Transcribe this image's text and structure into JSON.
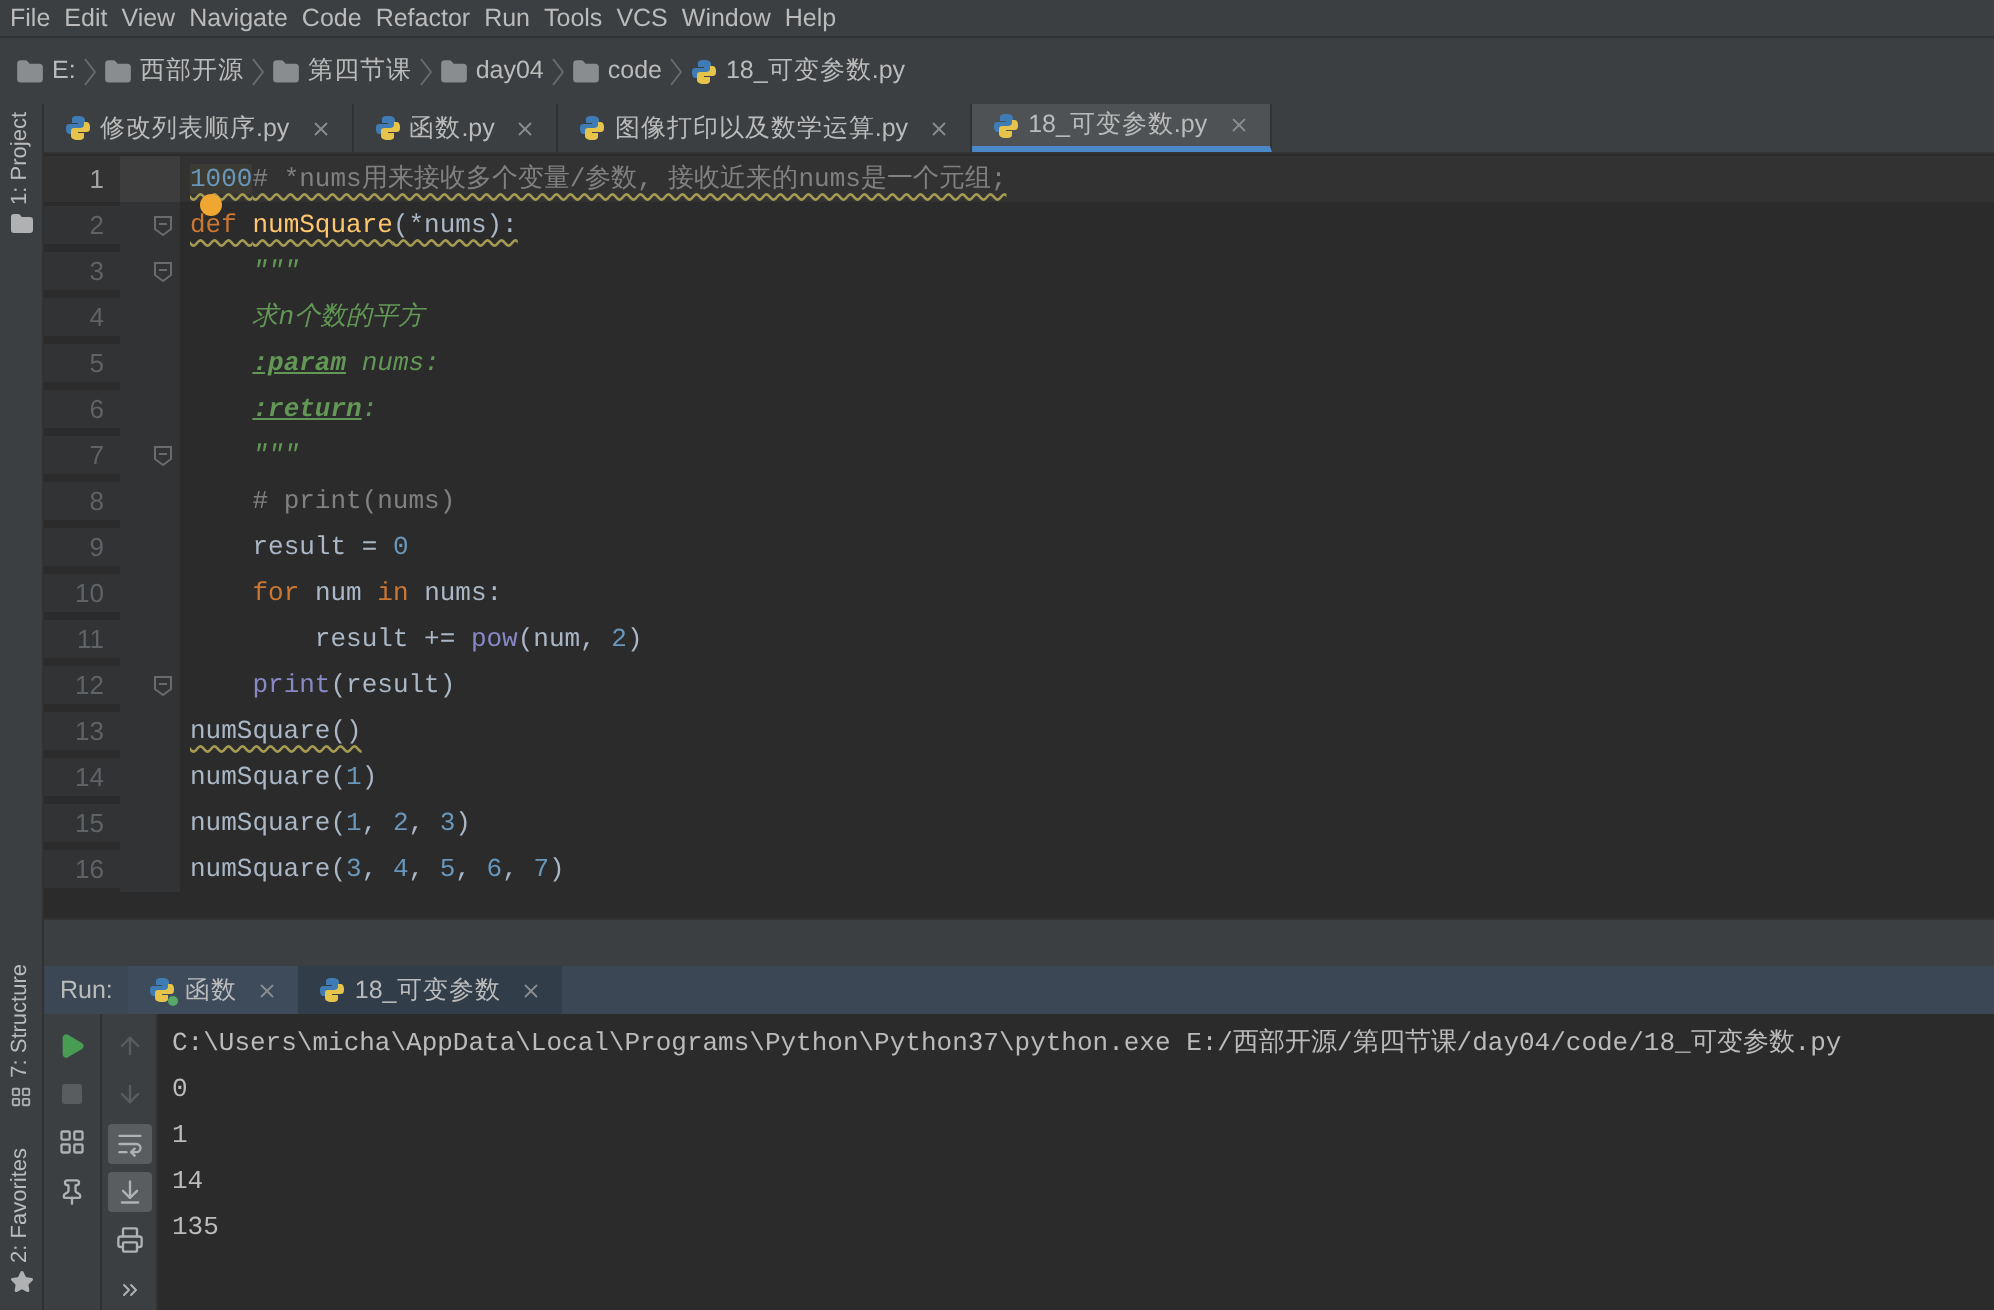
{
  "menu": [
    "File",
    "Edit",
    "View",
    "Navigate",
    "Code",
    "Refactor",
    "Run",
    "Tools",
    "VCS",
    "Window",
    "Help"
  ],
  "breadcrumb": [
    {
      "label": "E:",
      "kind": "folder"
    },
    {
      "label": "西部开源",
      "kind": "folder"
    },
    {
      "label": "第四节课",
      "kind": "folder"
    },
    {
      "label": "day04",
      "kind": "folder"
    },
    {
      "label": "code",
      "kind": "folder"
    },
    {
      "label": "18_可变参数.py",
      "kind": "file"
    }
  ],
  "left_tools": {
    "top": "1: Project",
    "middle": "7: Structure",
    "bottom": "2: Favorites"
  },
  "editor_tabs": [
    {
      "label": "修改列表顺序.py",
      "selected": false
    },
    {
      "label": "函数.py",
      "selected": false
    },
    {
      "label": "图像打印以及数学运算.py",
      "selected": false
    },
    {
      "label": "18_可变参数.py",
      "selected": true
    }
  ],
  "code_lines": [
    {
      "number": "1",
      "current": true,
      "warning": true,
      "fold": false,
      "bulb": false,
      "tokens": [
        {
          "text": "1000",
          "kind": "highlight"
        },
        {
          "text": "# *nums用来接收多个变量/参数, 接收近来的nums是一个元组;",
          "kind": "comment"
        }
      ]
    },
    {
      "number": "2",
      "current": false,
      "warning": true,
      "fold": true,
      "bulb": true,
      "tokens": [
        {
          "text": "def ",
          "kind": "keyword"
        },
        {
          "text": "numSquare",
          "kind": "funcdef"
        },
        {
          "text": "(*nums):",
          "kind": "plain"
        }
      ]
    },
    {
      "number": "3",
      "current": false,
      "warning": false,
      "fold": true,
      "bulb": false,
      "tokens": [
        {
          "text": "    \"\"\"",
          "kind": "doc"
        }
      ]
    },
    {
      "number": "4",
      "current": false,
      "warning": false,
      "fold": false,
      "bulb": false,
      "tokens": [
        {
          "text": "    求n个数的平方",
          "kind": "doc"
        }
      ]
    },
    {
      "number": "5",
      "current": false,
      "warning": false,
      "fold": false,
      "bulb": false,
      "tokens": [
        {
          "text": "    :param",
          "kind": "doctag"
        },
        {
          "text": " nums:",
          "kind": "doc"
        }
      ]
    },
    {
      "number": "6",
      "current": false,
      "warning": false,
      "fold": false,
      "bulb": false,
      "tokens": [
        {
          "text": "    :return",
          "kind": "doctag"
        },
        {
          "text": ":",
          "kind": "doc"
        }
      ]
    },
    {
      "number": "7",
      "current": false,
      "warning": false,
      "fold": true,
      "bulb": false,
      "tokens": [
        {
          "text": "    \"\"\"",
          "kind": "doc"
        }
      ]
    },
    {
      "number": "8",
      "current": false,
      "warning": false,
      "fold": false,
      "bulb": false,
      "tokens": [
        {
          "text": "    # print(nums)",
          "kind": "comment"
        }
      ]
    },
    {
      "number": "9",
      "current": false,
      "warning": false,
      "fold": false,
      "bulb": false,
      "tokens": [
        {
          "text": "    result = ",
          "kind": "plain"
        },
        {
          "text": "0",
          "kind": "number"
        }
      ]
    },
    {
      "number": "10",
      "current": false,
      "warning": false,
      "fold": false,
      "bulb": false,
      "tokens": [
        {
          "text": "    for",
          "kind": "keyword"
        },
        {
          "text": " num ",
          "kind": "plain"
        },
        {
          "text": "in",
          "kind": "keyword"
        },
        {
          "text": " nums:",
          "kind": "plain"
        }
      ]
    },
    {
      "number": "11",
      "current": false,
      "warning": false,
      "fold": false,
      "bulb": false,
      "tokens": [
        {
          "text": "        result += ",
          "kind": "plain"
        },
        {
          "text": "pow",
          "kind": "builtin"
        },
        {
          "text": "(num, ",
          "kind": "plain"
        },
        {
          "text": "2",
          "kind": "number"
        },
        {
          "text": ")",
          "kind": "plain"
        }
      ]
    },
    {
      "number": "12",
      "current": false,
      "warning": false,
      "fold": true,
      "bulb": false,
      "tokens": [
        {
          "text": "    print",
          "kind": "builtin"
        },
        {
          "text": "(result)",
          "kind": "plain"
        }
      ]
    },
    {
      "number": "13",
      "current": false,
      "warning": true,
      "fold": false,
      "bulb": false,
      "tokens": [
        {
          "text": "numSquare()",
          "kind": "plain"
        }
      ]
    },
    {
      "number": "14",
      "current": false,
      "warning": false,
      "fold": false,
      "bulb": false,
      "tokens": [
        {
          "text": "numSquare(",
          "kind": "plain"
        },
        {
          "text": "1",
          "kind": "number"
        },
        {
          "text": ")",
          "kind": "plain"
        }
      ]
    },
    {
      "number": "15",
      "current": false,
      "warning": false,
      "fold": false,
      "bulb": false,
      "tokens": [
        {
          "text": "numSquare(",
          "kind": "plain"
        },
        {
          "text": "1",
          "kind": "number"
        },
        {
          "text": ", ",
          "kind": "plain"
        },
        {
          "text": "2",
          "kind": "number"
        },
        {
          "text": ", ",
          "kind": "plain"
        },
        {
          "text": "3",
          "kind": "number"
        },
        {
          "text": ")",
          "kind": "plain"
        }
      ]
    },
    {
      "number": "16",
      "current": false,
      "warning": false,
      "fold": false,
      "bulb": false,
      "tokens": [
        {
          "text": "numSquare(",
          "kind": "plain"
        },
        {
          "text": "3",
          "kind": "number"
        },
        {
          "text": ", ",
          "kind": "plain"
        },
        {
          "text": "4",
          "kind": "number"
        },
        {
          "text": ", ",
          "kind": "plain"
        },
        {
          "text": "5",
          "kind": "number"
        },
        {
          "text": ", ",
          "kind": "plain"
        },
        {
          "text": "6",
          "kind": "number"
        },
        {
          "text": ", ",
          "kind": "plain"
        },
        {
          "text": "7",
          "kind": "number"
        },
        {
          "text": ")",
          "kind": "plain"
        }
      ]
    }
  ],
  "run_panel": {
    "label": "Run:",
    "tabs": [
      {
        "label": "函数",
        "selected": false,
        "running": true
      },
      {
        "label": "18_可变参数",
        "selected": true,
        "running": false
      }
    ],
    "tools_left": [
      {
        "kind": "play"
      },
      {
        "kind": "stop"
      },
      {
        "kind": "layout"
      },
      {
        "kind": "pin"
      }
    ],
    "tools_right": [
      {
        "kind": "up",
        "active": false
      },
      {
        "kind": "down",
        "active": false
      },
      {
        "kind": "wrap",
        "active": true
      },
      {
        "kind": "scroll-end",
        "active": true
      },
      {
        "kind": "print",
        "active": false
      },
      {
        "kind": "more",
        "active": false
      }
    ],
    "output": [
      "C:\\Users\\micha\\AppData\\Local\\Programs\\Python\\Python37\\python.exe E:/西部开源/第四节课/day04/code/18_可变参数.py",
      "0",
      "1",
      "14",
      "135"
    ]
  }
}
